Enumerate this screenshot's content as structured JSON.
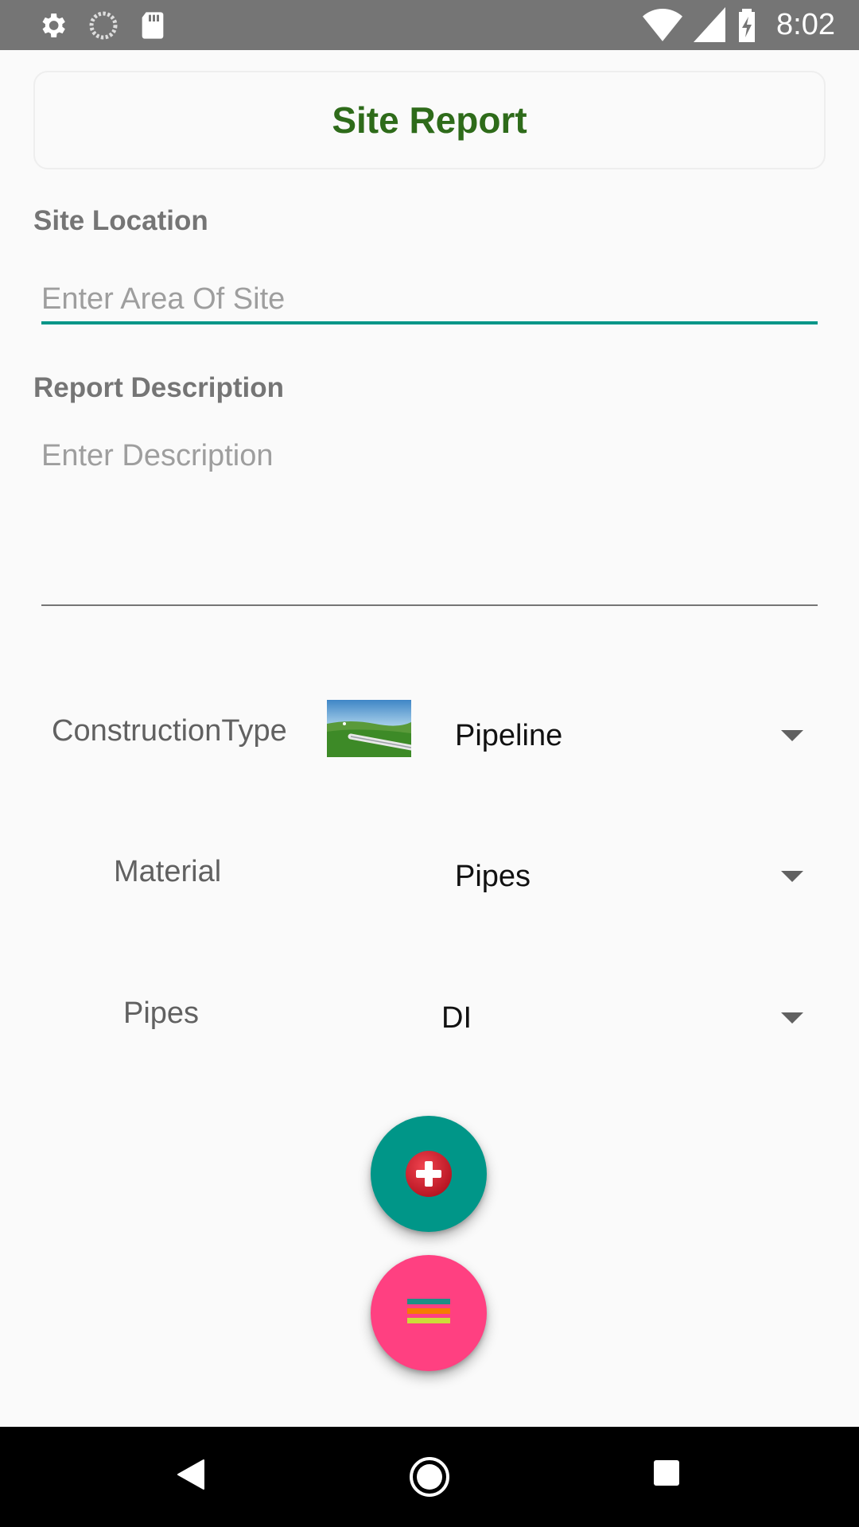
{
  "status_bar": {
    "time": "8:02",
    "left_icons": [
      "gear-icon",
      "sync-icon",
      "sd-card-icon"
    ],
    "right_icons": [
      "wifi-icon",
      "signal-icon",
      "battery-charging-icon"
    ]
  },
  "header": {
    "title": "Site Report"
  },
  "site_location": {
    "label": "Site Location",
    "placeholder": "Enter Area Of Site",
    "value": ""
  },
  "report_description": {
    "label": "Report Description",
    "placeholder": "Enter Description",
    "value": ""
  },
  "construction_type": {
    "label": "ConstructionType",
    "value": "Pipeline"
  },
  "material": {
    "label": "Material",
    "value": "Pipes"
  },
  "pipes": {
    "label": "Pipes",
    "value": "DI"
  },
  "fabs": {
    "add_icon": "medical-cross-icon",
    "menu_icon": "menu-lines-icon"
  },
  "nav_bar": {
    "icons": [
      "back-icon",
      "home-icon",
      "recents-icon"
    ]
  },
  "colors": {
    "status_bar": "#757575",
    "title": "#2e6b1a",
    "accent": "#009688",
    "fab_menu": "#ff4081"
  }
}
